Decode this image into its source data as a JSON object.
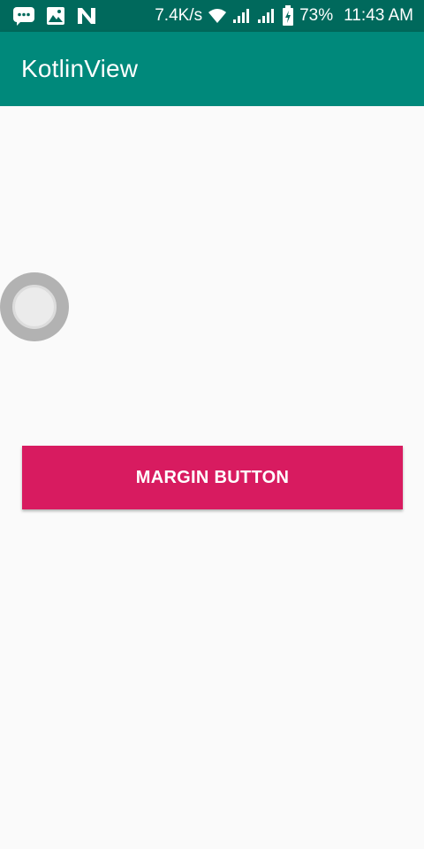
{
  "status_bar": {
    "icons_left": [
      "message-icon",
      "image-icon",
      "n-logo-icon"
    ],
    "network_speed": "7.4K/s",
    "icons_right": [
      "wifi-icon",
      "signal-icon",
      "signal-icon-2",
      "battery-charging-icon"
    ],
    "battery_percent": "73%",
    "time": "11:43 AM",
    "background_color": "#00695c"
  },
  "app_bar": {
    "title": "KotlinView",
    "background_color": "#00897b"
  },
  "main": {
    "radio_state": "unchecked",
    "button_label": "MARGIN BUTTON",
    "button_color": "#d81b60"
  }
}
